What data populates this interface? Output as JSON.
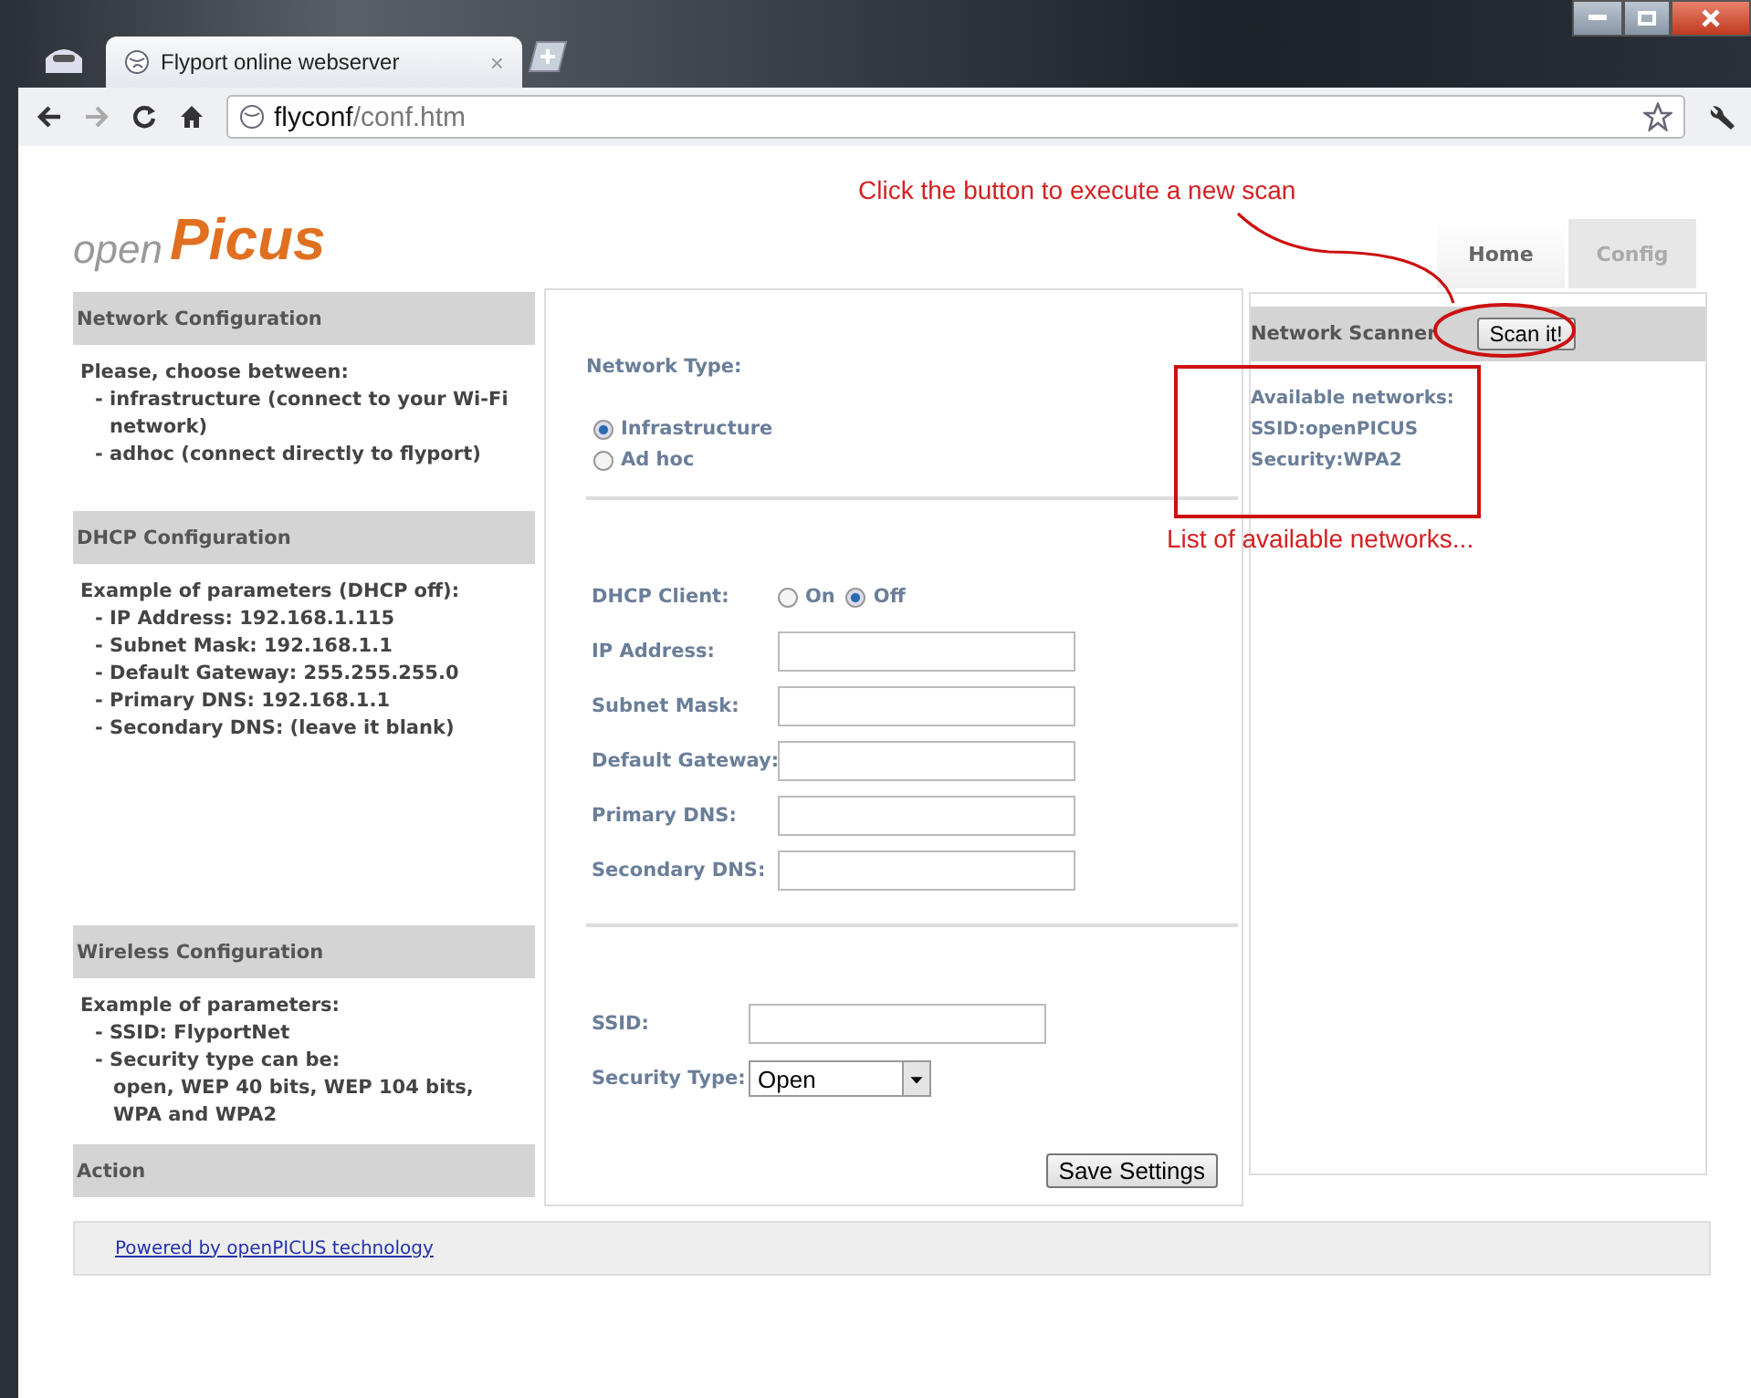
{
  "browser": {
    "tab_title": "Flyport online webserver",
    "tab_close": "×",
    "url_host": "flyconf",
    "url_path": "/conf.htm"
  },
  "logo": {
    "prefix": "open",
    "name": "Picus"
  },
  "annotations": {
    "scan_note": "Click the button to execute a new scan",
    "list_note": "List of available networks..."
  },
  "nav": [
    {
      "label": "Home",
      "selected": false
    },
    {
      "label": "Config",
      "selected": true
    }
  ],
  "sidebar": [
    {
      "title": "Network Configuration",
      "lines": [
        {
          "kind": "intro",
          "text": "Please, choose between:"
        },
        {
          "kind": "bullet",
          "text": "- infrastructure (connect to your Wi-Fi network)"
        },
        {
          "kind": "bullet",
          "text": "- adhoc (connect directly to flyport)"
        }
      ]
    },
    {
      "title": "DHCP Configuration",
      "lines": [
        {
          "kind": "intro",
          "text": "Example of parameters (DHCP off):"
        },
        {
          "kind": "bullet",
          "text": "- IP Address: 192.168.1.115"
        },
        {
          "kind": "bullet",
          "text": "- Subnet Mask: 192.168.1.1"
        },
        {
          "kind": "bullet",
          "text": "- Default Gateway: 255.255.255.0"
        },
        {
          "kind": "bullet",
          "text": "- Primary DNS: 192.168.1.1"
        },
        {
          "kind": "bullet",
          "text": "- Secondary DNS: (leave it blank)"
        }
      ]
    },
    {
      "title": "Wireless Configuration",
      "lines": [
        {
          "kind": "intro",
          "text": "Example of parameters:"
        },
        {
          "kind": "bullet",
          "text": "- SSID: FlyportNet"
        },
        {
          "kind": "bullet",
          "text": "- Security type can be:"
        },
        {
          "kind": "continuation",
          "text": "open, WEP 40 bits, WEP 104 bits, WPA and WPA2"
        }
      ]
    },
    {
      "title": "Action"
    }
  ],
  "form": {
    "network_type": {
      "label": "Network Type:",
      "options": [
        {
          "label": "Infrastructure",
          "selected": true
        },
        {
          "label": "Ad hoc",
          "selected": false
        }
      ]
    },
    "dhcp_client": {
      "label": "DHCP Client:",
      "options": [
        {
          "label": "On",
          "selected": false
        },
        {
          "label": "Off",
          "selected": true
        }
      ]
    },
    "fields": [
      {
        "label": "IP Address:"
      },
      {
        "label": "Subnet Mask:"
      },
      {
        "label": "Default Gateway:"
      },
      {
        "label": "Primary DNS:"
      },
      {
        "label": "Secondary DNS:"
      }
    ],
    "ssid": {
      "label": "SSID:"
    },
    "security_type": {
      "label": "Security Type:",
      "value": "Open"
    },
    "save_button": "Save Settings"
  },
  "scanner": {
    "title": "Network Scanner",
    "button": "Scan it!",
    "results": [
      "Available networks:",
      "SSID:openPICUS",
      "Security:WPA2"
    ]
  },
  "footer": {
    "link": "Powered by openPICUS technology"
  }
}
